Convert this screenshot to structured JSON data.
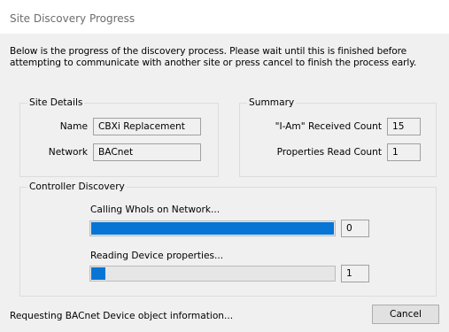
{
  "window": {
    "title": "Site Discovery Progress"
  },
  "description": "Below is the progress of the discovery process. Please wait until this is finished before attempting to communicate with another site or press cancel to finish the process early.",
  "site_details": {
    "title": "Site Details",
    "name_label": "Name",
    "name_value": "CBXi Replacement",
    "network_label": "Network",
    "network_value": "BACnet"
  },
  "summary": {
    "title": "Summary",
    "iam_label": "\"I-Am\" Received Count",
    "iam_value": "15",
    "props_label": "Properties Read Count",
    "props_value": "1"
  },
  "controller_discovery": {
    "title": "Controller Discovery",
    "step1_label": "Calling WhoIs on Network...",
    "step1_progress": 1.0,
    "step1_count": "0",
    "step2_label": "Reading Device properties...",
    "step2_progress": 0.06,
    "step2_count": "1",
    "accent": "#0675d6"
  },
  "status_text": "Requesting BACnet Device object information...",
  "buttons": {
    "cancel_label": "Cancel"
  }
}
